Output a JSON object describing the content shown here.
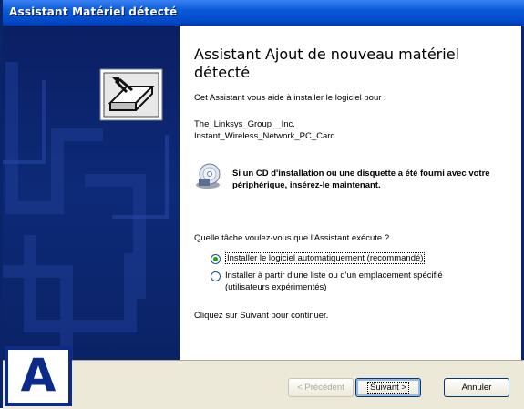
{
  "window": {
    "title": "Assistant Matériel détecté"
  },
  "heading": "Assistant Ajout de nouveau matériel détecté",
  "intro": "Cet Assistant vous aide à installer le logiciel pour :",
  "device": {
    "line1": "The_Linksys_Group__Inc.",
    "line2": "Instant_Wireless_Network_PC_Card"
  },
  "cd_prompt": "Si un CD d'installation ou une disquette a été fourni avec votre périphérique, insérez-le maintenant.",
  "question": "Quelle tâche voulez-vous que l'Assistant exécute ?",
  "options": [
    {
      "label": "Installer le logiciel automatiquement (recommandé)",
      "selected": true
    },
    {
      "line1": "Installer à partir d'une liste ou d'un emplacement spécifié",
      "line2": "(utilisateurs expérimentés)",
      "selected": false
    }
  ],
  "footer_text": "Cliquez sur Suivant pour continuer.",
  "buttons": {
    "back": "< Précédent",
    "next": "Suivant >",
    "cancel": "Annuler"
  },
  "badge": "A",
  "icons": {
    "wizard": "hardware-wizard-icon",
    "cd": "cd-floppy-icon"
  },
  "colors": {
    "titlebar": "#0049c9",
    "sidebar": "#0d2a78",
    "badge": "#0b2a8a",
    "radio_selected": "#1a9e1a"
  }
}
